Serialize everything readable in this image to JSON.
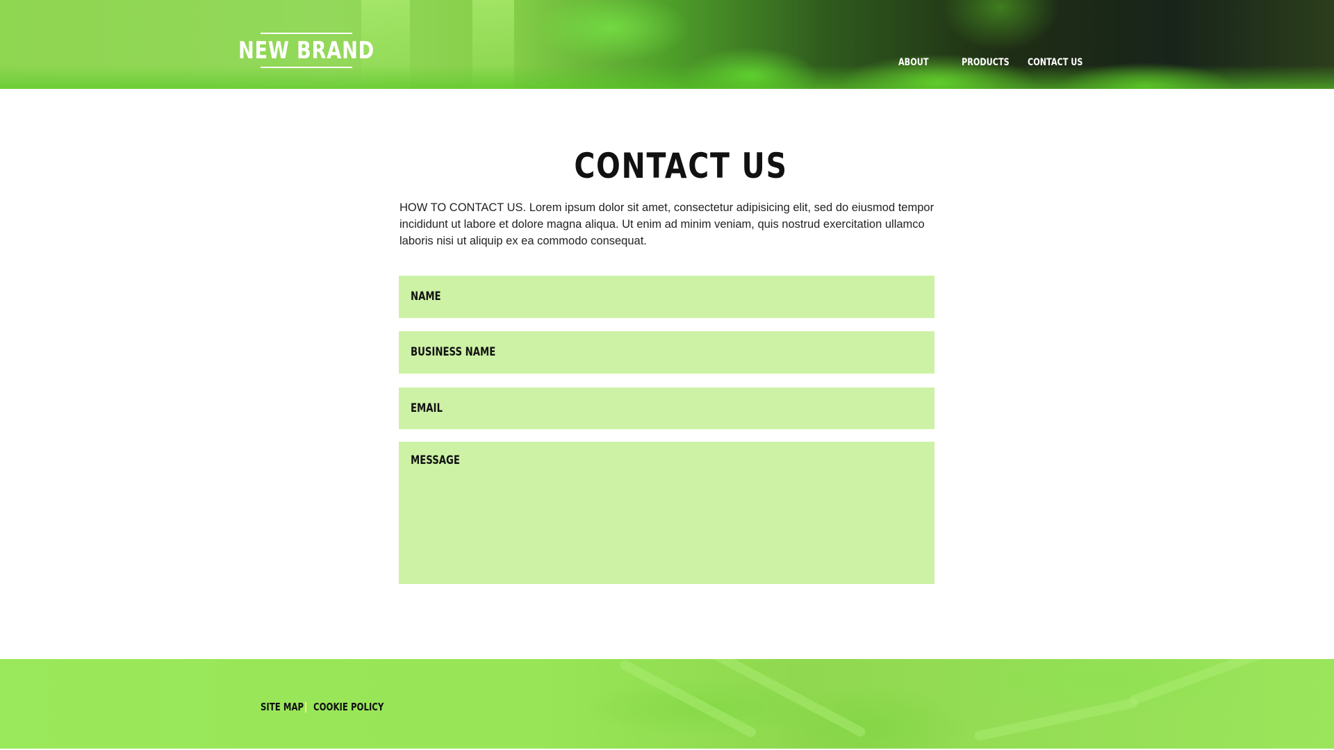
{
  "header": {
    "logo": "NEW BRAND",
    "nav": [
      {
        "label": "ABOUT"
      },
      {
        "label": "PRODUCTS"
      },
      {
        "label": "CONTACT US"
      }
    ]
  },
  "main": {
    "title": "CONTACT US",
    "intro": "HOW TO CONTACT US. Lorem ipsum dolor sit amet, consectetur adipisicing elit, sed do eiusmod tempor incididunt ut labore et dolore magna aliqua. Ut enim ad minim veniam, quis nostrud exercitation ullamco laboris nisi ut aliquip ex ea commodo consequat.",
    "form": {
      "fields": [
        {
          "label": "NAME"
        },
        {
          "label": "BUSINESS NAME"
        },
        {
          "label": "EMAIL"
        },
        {
          "label": "MESSAGE"
        }
      ]
    }
  },
  "footer": {
    "links": [
      {
        "label": "SITE MAP"
      },
      {
        "label": "COOKIE POLICY"
      }
    ]
  },
  "colors": {
    "field_background": "#cdf2a6",
    "footer_background": "#98e657",
    "footer_separator": "#f4f86a",
    "text": "#111111"
  }
}
